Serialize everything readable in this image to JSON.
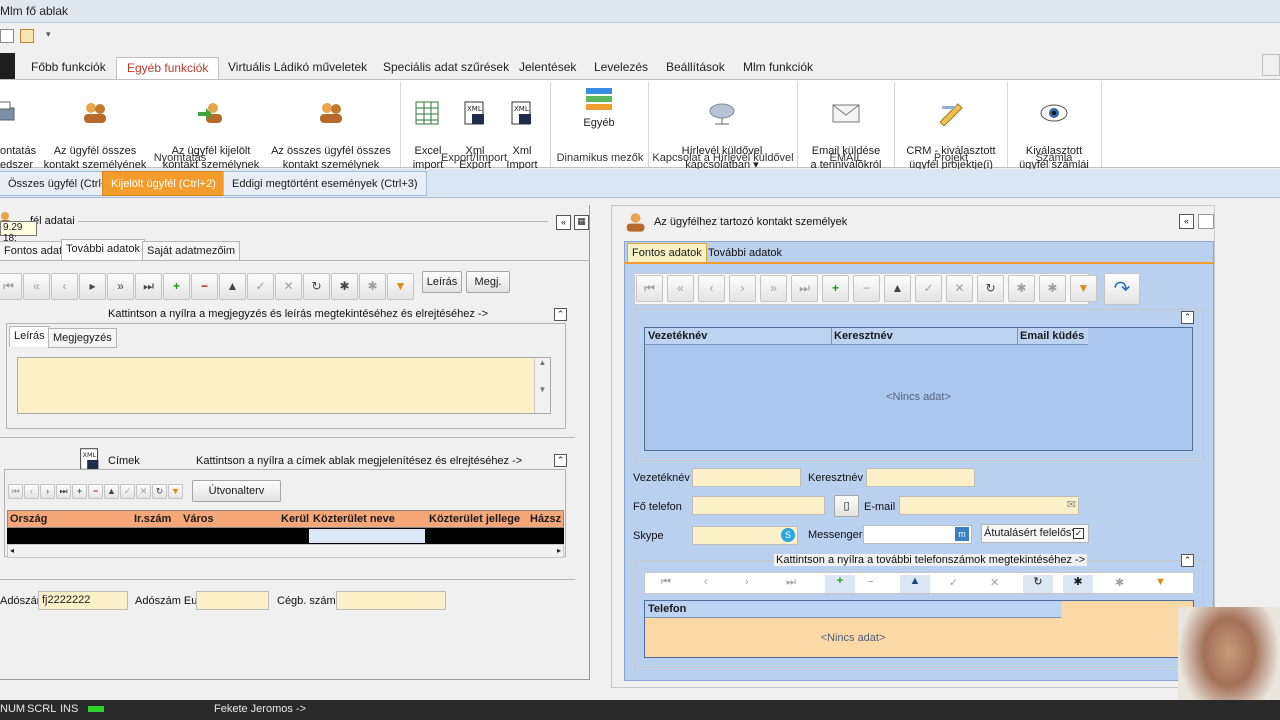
{
  "window": {
    "title": "Mlm fő ablak"
  },
  "ribbon_tabs": [
    "Főbb funkciók",
    "Egyéb funkciók",
    "Virtuális Ládikó műveletek",
    "Speciális adat szűrések",
    "Jelentések",
    "Levelezés",
    "Beállítások",
    "Mlm funkciók"
  ],
  "ribbon": {
    "btn_nyomtatas_partial": "ontatás\nedszer",
    "btn_osszes_kontakt": "Az ügyfél összes\nkontakt személyének",
    "btn_kijelolt_kontakt": "Az ügyfél kijelölt\nkontakt személynek",
    "btn_osszes_ugyfel_kontakt": "Az összes ügyfél összes\nkontakt személynek",
    "group_nyomtatas": "Nyomtatás",
    "btn_excel": "Excel\nimport",
    "btn_xml_export": "Xml\nExport",
    "btn_xml_import": "Xml\nImport",
    "group_export": "Export/Import",
    "btn_egyeb": "Egyéb",
    "group_dinamikus": "Dinamikus mezők",
    "btn_hirlevel": "Hírlevél küldővel\nkapcsolatban ▾",
    "group_hirlevel": "Kapcsolat a Hírlevél küldővel",
    "btn_email": "Email küldése\na tennivalókról",
    "group_email": "EMAIL",
    "btn_crm": "CRM - kiválasztott\nügyfél projektje(i)",
    "group_projekt": "Projekt",
    "btn_szamla": "Kiválasztott\nügyfél számlái",
    "group_szamla": "Számla"
  },
  "doc_tabs": [
    "Összes ügyfél (Ctrl+1)",
    "Kijelölt ügyfél (Ctrl+2)",
    "Eddigi megtörtént események (Ctrl+3)"
  ],
  "left": {
    "header_partial": "fél adatai",
    "tooltip": "9.29 18:",
    "tabs": [
      "Fontos adatok",
      "További adatok",
      "Saját adatmezőim"
    ],
    "btn_leiras": "Leírás",
    "btn_megj": "Megj.",
    "notes_hint": "Kattintson a nyílra a megjegyzés és leírás megtekintéséhez és elrejtéséhez ->",
    "notes_tabs": [
      "Leírás",
      "Megjegyzés"
    ],
    "cimek_label": "Címek",
    "cimek_hint": "Kattintson a nyílra a címek ablak megjelenítésez és elrejtéséhez ->",
    "btn_utvonalterv": "Útvonalterv",
    "grid_columns": [
      "Ország",
      "Ir.szám",
      "Város",
      "Kerül",
      "Közterület neve",
      "Közterület jellege",
      "Házsz"
    ],
    "label_adoszam": "Adószám",
    "value_adoszam": "fj2222222",
    "label_adoszam_eu": "Adószám Eu",
    "label_cegb": "Cégb. szám"
  },
  "right": {
    "header": "Az ügyfélhez tartozó kontakt személyek",
    "tabs": [
      "Fontos adatok",
      "További adatok"
    ],
    "grid_columns": [
      "Vezetéknév",
      "Keresztnév",
      "Email küdés"
    ],
    "no_data": "<Nincs adat>",
    "label_vezeteknev": "Vezetéknév",
    "label_keresztnev": "Keresztnév",
    "label_fotelefon": "Fő telefon",
    "label_email": "E-mail",
    "label_skype": "Skype",
    "label_messenger": "Messenger",
    "label_atutalas": "Átutalásért felelős?",
    "phones_hint": "Kattintson a nyílra a további telefonszámok megtekintéséhez ->",
    "phone_column": "Telefon",
    "phone_no_data": "<Nincs adat>"
  },
  "status": {
    "num": "NUM",
    "scrl": "SCRL",
    "ins": "INS",
    "user": "Fekete Jeromos ->"
  },
  "colors": {
    "accent_orange": "#f39c2c",
    "field_yellow": "#fbf0c8",
    "grid_blue": "#aac8ee"
  }
}
